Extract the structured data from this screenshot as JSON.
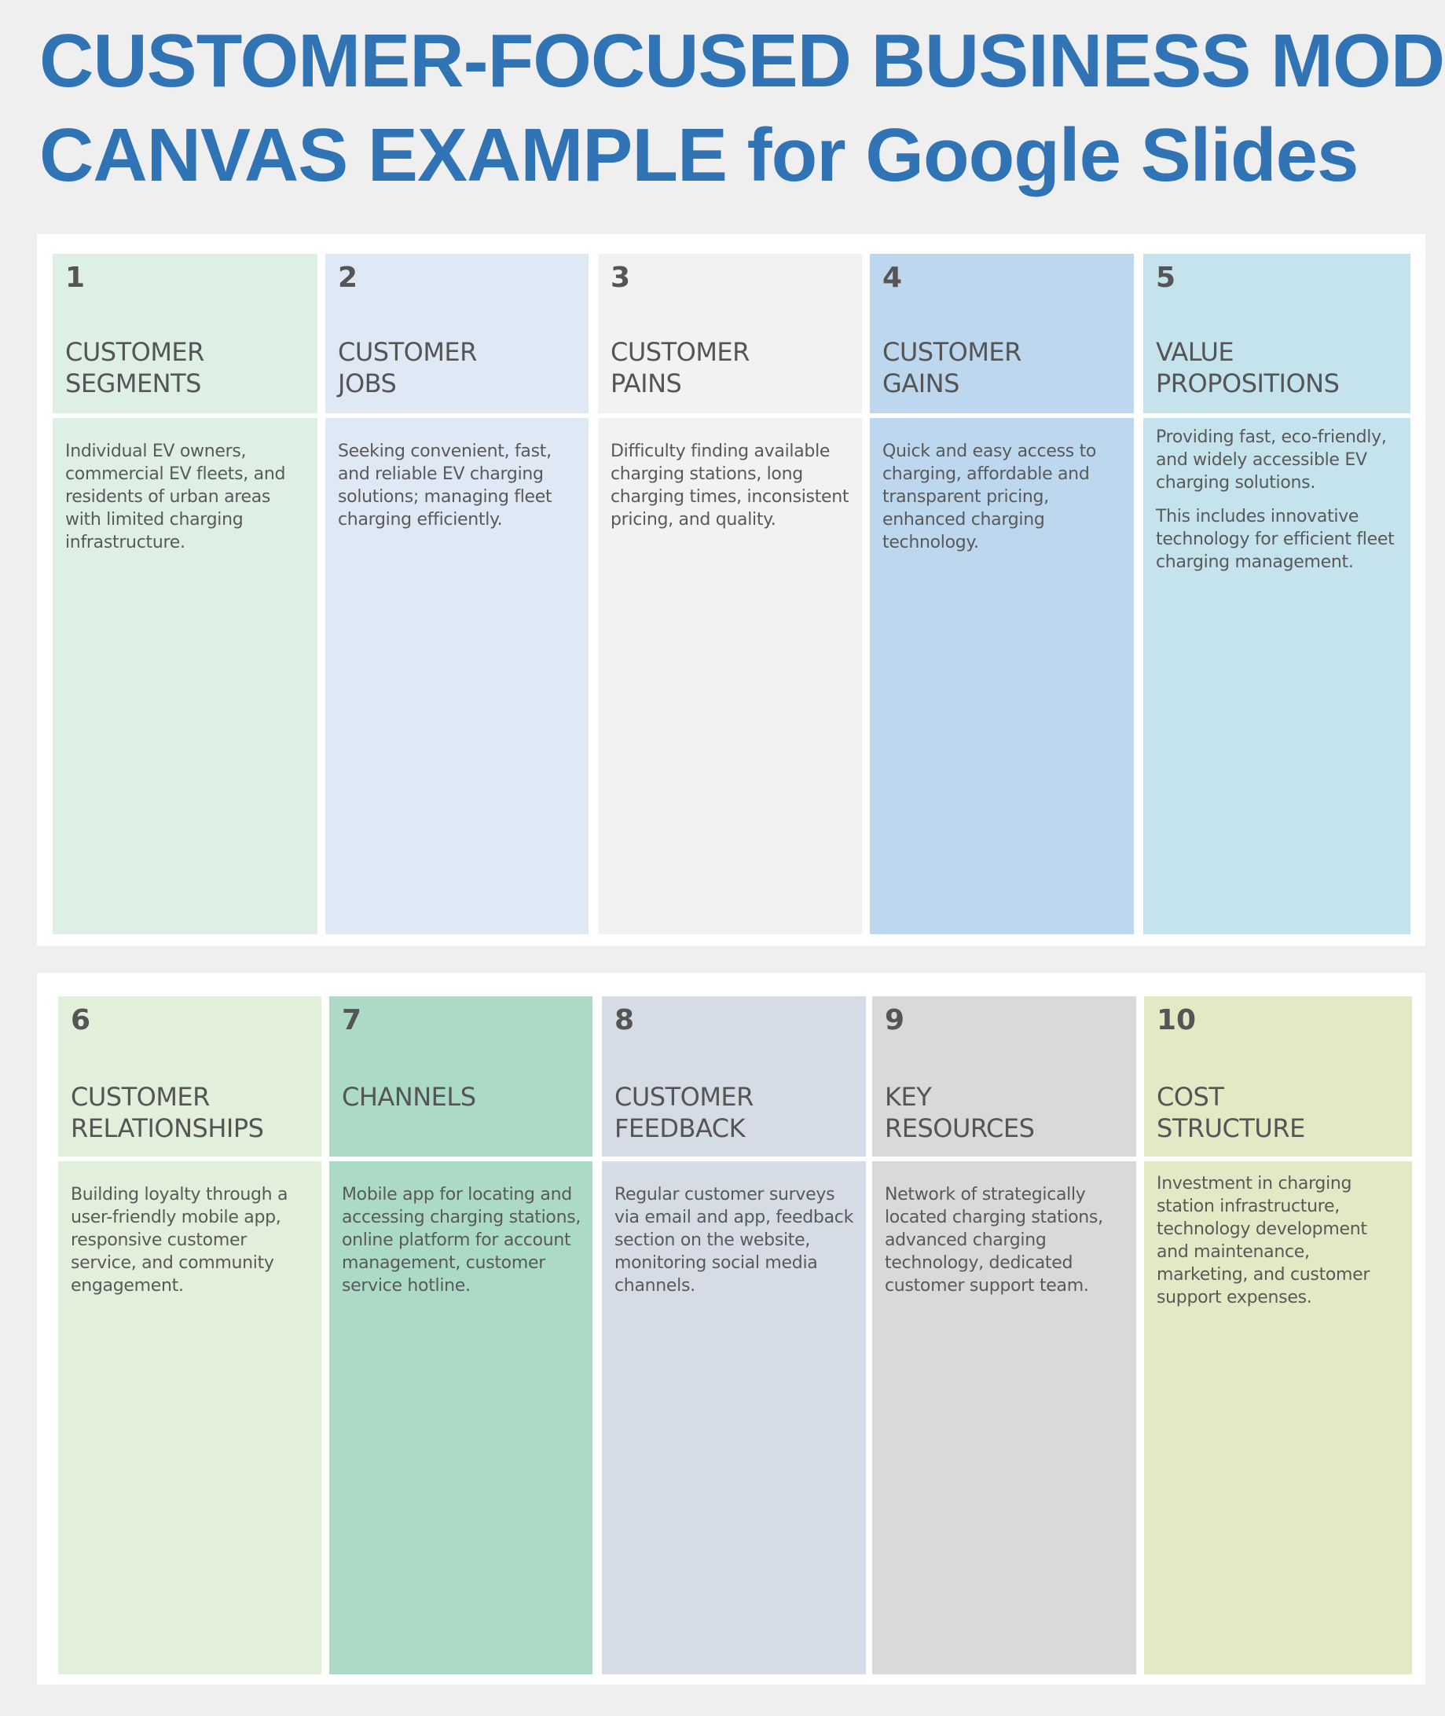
{
  "title": {
    "line1": "CUSTOMER-FOCUSED BUSINESS MODEL",
    "line2": "CANVAS EXAMPLE for Google Slides",
    "color": "#3174b5"
  },
  "rows": [
    {
      "cells": [
        {
          "number": "1",
          "label_lines": [
            "CUSTOMER",
            "SEGMENTS"
          ],
          "color": "#deefe5",
          "paragraphs": [
            "Individual EV owners, commercial EV fleets, and residents of urban areas with limited charging infrastructure."
          ]
        },
        {
          "number": "2",
          "label_lines": [
            "CUSTOMER",
            "JOBS"
          ],
          "color": "#dfe8f5",
          "paragraphs": [
            "Seeking convenient, fast, and reliable EV charging solutions; managing fleet charging efficiently."
          ]
        },
        {
          "number": "3",
          "label_lines": [
            "CUSTOMER",
            "PAINS"
          ],
          "color": "#f2f2f2",
          "paragraphs": [
            "Difficulty finding available charging stations, long charging times, inconsistent pricing, and quality."
          ]
        },
        {
          "number": "4",
          "label_lines": [
            "CUSTOMER",
            "GAINS"
          ],
          "color": "#bdd7ee",
          "paragraphs": [
            "Quick and easy access to charging, affordable and transparent pricing, enhanced charging technology."
          ]
        },
        {
          "number": "5",
          "label_lines": [
            "VALUE",
            "PROPOSITIONS"
          ],
          "color": "#c5e3ed",
          "paragraphs": [
            "Providing fast, eco-friendly, and widely accessible EV charging solutions.",
            "This includes innovative technology for efficient fleet charging management."
          ]
        }
      ]
    },
    {
      "cells": [
        {
          "number": "6",
          "label_lines": [
            "CUSTOMER",
            "RELATIONSHIPS"
          ],
          "color": "#e2efda",
          "paragraphs": [
            "Building loyalty through a user-friendly mobile app, responsive customer service, and community engagement."
          ]
        },
        {
          "number": "7",
          "label_lines": [
            "CHANNELS",
            ""
          ],
          "color": "#abdbc7",
          "paragraphs": [
            "Mobile app for locating and accessing charging stations, online platform for account management, customer service hotline."
          ]
        },
        {
          "number": "8",
          "label_lines": [
            "CUSTOMER",
            "FEEDBACK"
          ],
          "color": "#d6dce5",
          "paragraphs": [
            "Regular customer surveys via email and app, feedback section on the website, monitoring social media channels."
          ]
        },
        {
          "number": "9",
          "label_lines": [
            "KEY",
            "RESOURCES"
          ],
          "color": "#d9d9d9",
          "paragraphs": [
            "Network of strategically located charging stations, advanced charging technology, dedicated customer support team."
          ]
        },
        {
          "number": "10",
          "label_lines": [
            "COST",
            "STRUCTURE"
          ],
          "color": "#e2e9c4",
          "paragraphs": [
            "Investment in charging station infrastructure, technology development and maintenance, marketing, and customer support expenses."
          ]
        }
      ]
    }
  ]
}
